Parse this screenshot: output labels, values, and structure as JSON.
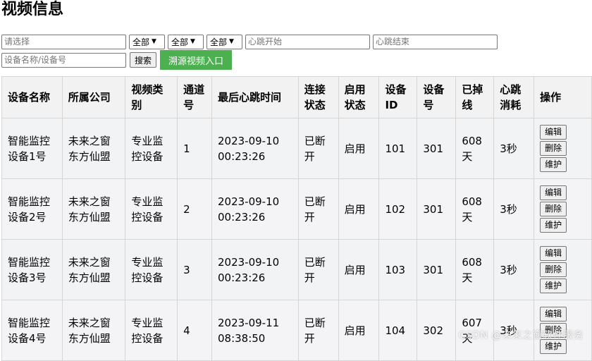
{
  "page": {
    "title": "视频信息"
  },
  "filters": {
    "keyword_placeholder": "请选择",
    "select_1": "全部",
    "select_2": "全部",
    "select_3": "全部",
    "heartbeat_start_placeholder": "心跳开始",
    "heartbeat_end_placeholder": "心跳结束",
    "device_placeholder": "设备名称/设备号",
    "search_label": "搜索",
    "trace_entry_label": "溯源视频入口"
  },
  "table": {
    "headers": [
      "设备名称",
      "所属公司",
      "视频类别",
      "通道号",
      "最后心跳时间",
      "连接状态",
      "启用状态",
      "设备ID",
      "设备号",
      "已掉线",
      "心跳消耗",
      "操作"
    ],
    "actions": {
      "edit": "编辑",
      "delete": "删除",
      "maintain": "维护"
    },
    "rows": [
      {
        "name": "智能监控设备1号",
        "company": "未来之窗东方仙盟",
        "category": "专业监控设备",
        "channel": "1",
        "last_heartbeat": "2023-09-10 00:23:26",
        "connection": "已断开",
        "enabled": "启用",
        "device_id": "101",
        "device_no": "301",
        "offline": "608天",
        "heartbeat_cost": "3秒"
      },
      {
        "name": "智能监控设备2号",
        "company": "未来之窗东方仙盟",
        "category": "专业监控设备",
        "channel": "2",
        "last_heartbeat": "2023-09-10 00:23:26",
        "connection": "已断开",
        "enabled": "启用",
        "device_id": "102",
        "device_no": "301",
        "offline": "608天",
        "heartbeat_cost": "3秒"
      },
      {
        "name": "智能监控设备3号",
        "company": "未来之窗东方仙盟",
        "category": "专业监控设备",
        "channel": "3",
        "last_heartbeat": "2023-09-10 00:23:26",
        "connection": "已断开",
        "enabled": "启用",
        "device_id": "103",
        "device_no": "301",
        "offline": "608天",
        "heartbeat_cost": "3秒"
      },
      {
        "name": "智能监控设备4号",
        "company": "未来之窗东方仙盟",
        "category": "专业监控设备",
        "channel": "4",
        "last_heartbeat": "2023-09-11 08:38:50",
        "connection": "已断开",
        "enabled": "启用",
        "device_id": "104",
        "device_no": "302",
        "offline": "607天",
        "heartbeat_cost": "3秒"
      }
    ]
  },
  "watermark": "CSDN @未来之窗软件服务",
  "colors": {
    "accent_green": "#4caf50"
  }
}
